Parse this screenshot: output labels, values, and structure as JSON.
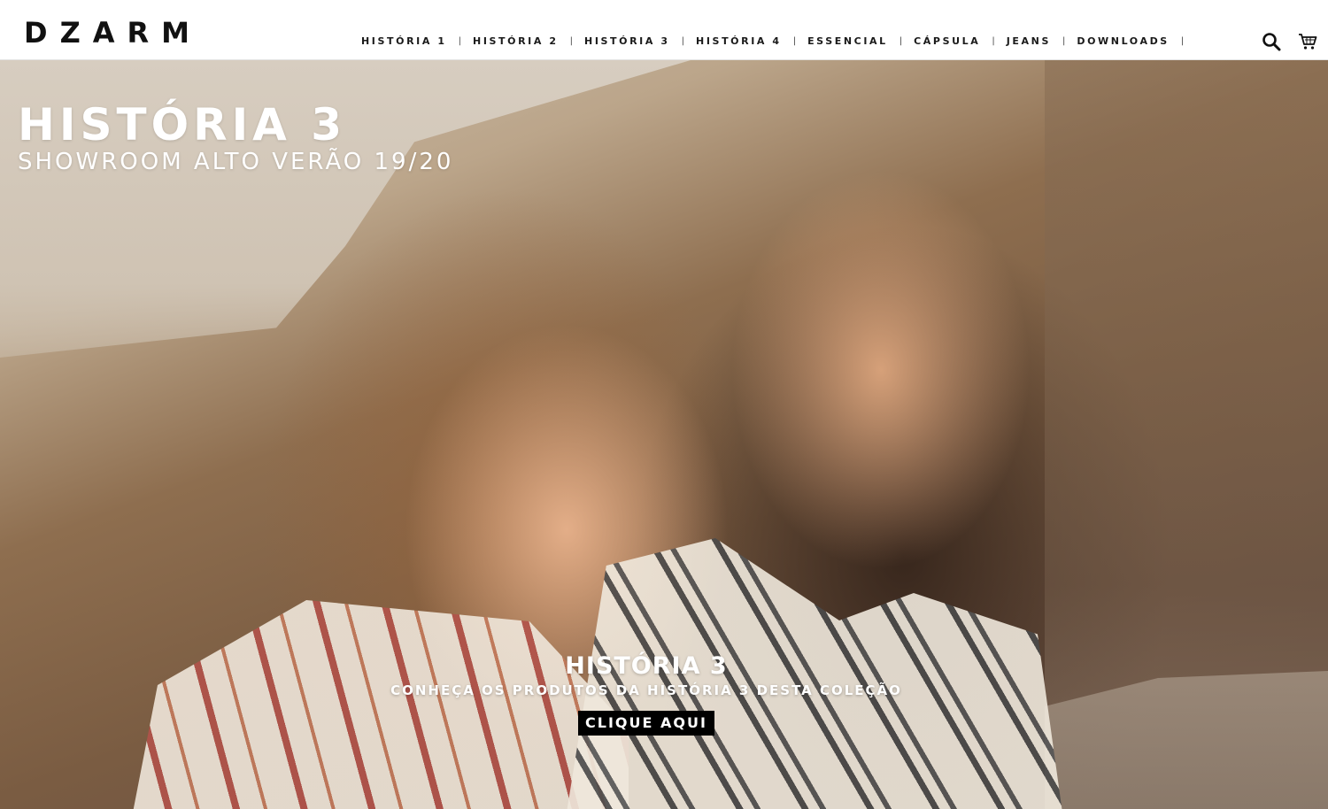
{
  "header": {
    "logo": "DZARM",
    "nav": [
      {
        "label": "HISTÓRIA 1"
      },
      {
        "label": "HISTÓRIA 2"
      },
      {
        "label": "HISTÓRIA 3"
      },
      {
        "label": "HISTÓRIA 4"
      },
      {
        "label": "ESSENCIAL"
      },
      {
        "label": "CÁPSULA"
      },
      {
        "label": "JEANS"
      },
      {
        "label": "DOWNLOADS"
      }
    ],
    "separator": "|",
    "icons": {
      "search": "search-icon",
      "cart": "cart-icon"
    }
  },
  "hero": {
    "title": "HISTÓRIA 3",
    "subtitle": "SHOWROOM ALTO VERÃO 19/20",
    "cta": {
      "title": "HISTÓRIA 3",
      "description": "CONHEÇA OS PRODUTOS DA HISTÓRIA 3 DESTA COLEÇÃO",
      "button": "CLIQUE AQUI"
    }
  },
  "colors": {
    "header_bg": "#ffffff",
    "text_dark": "#111111",
    "button_bg": "#000000",
    "button_text": "#ffffff"
  }
}
